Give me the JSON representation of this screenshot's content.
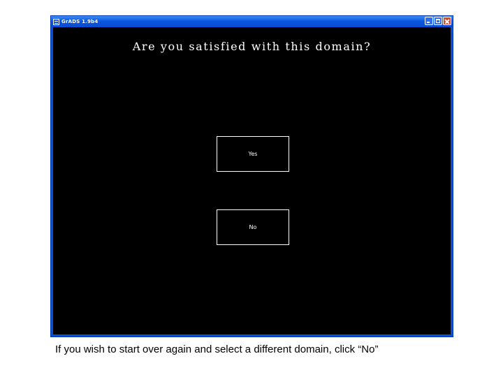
{
  "window": {
    "title": "GrADS 1.9b4",
    "buttons": {
      "minimize": "minimize-icon",
      "maximize": "maximize-icon",
      "close": "close-icon"
    }
  },
  "canvas": {
    "question": "Are you satisfied with this domain?",
    "yes_label": "Yes",
    "no_label": "No"
  },
  "caption": "If you wish to start over again and select a different domain, click “No”",
  "colors": {
    "titlebar": "#0a4fd6",
    "canvas": "#000000",
    "text": "#ffffff"
  }
}
